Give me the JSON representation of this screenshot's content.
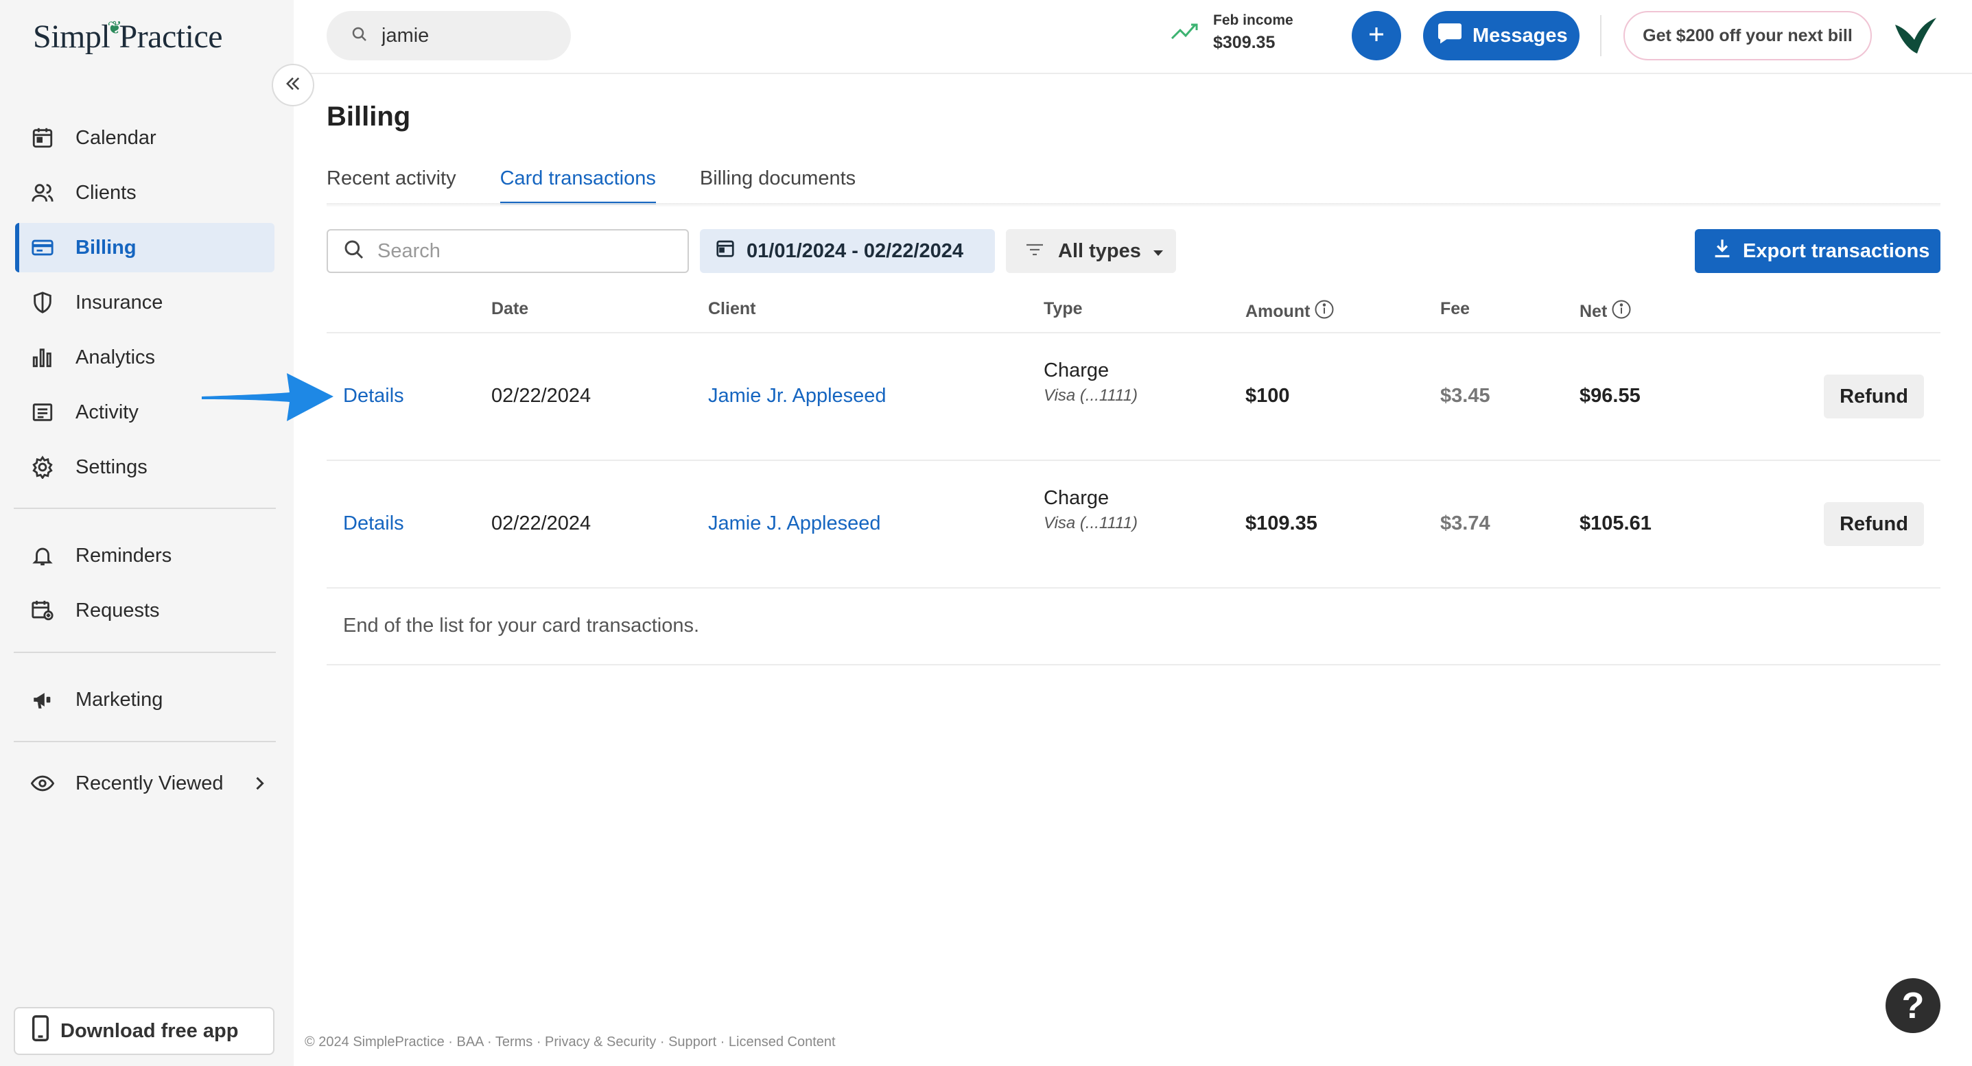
{
  "sidebar": {
    "logo_left": "Simpl",
    "logo_leaf": "❦",
    "logo_right": "Practice",
    "items": [
      {
        "label": "Calendar",
        "icon": "calendar-icon"
      },
      {
        "label": "Clients",
        "icon": "clients-icon"
      },
      {
        "label": "Billing",
        "icon": "billing-icon",
        "active": true
      },
      {
        "label": "Insurance",
        "icon": "shield-icon"
      },
      {
        "label": "Analytics",
        "icon": "analytics-icon"
      },
      {
        "label": "Activity",
        "icon": "activity-icon"
      },
      {
        "label": "Settings",
        "icon": "gear-icon"
      },
      {
        "label": "Reminders",
        "icon": "bell-icon"
      },
      {
        "label": "Requests",
        "icon": "requests-icon"
      },
      {
        "label": "Marketing",
        "icon": "megaphone-icon"
      },
      {
        "label": "Recently Viewed",
        "icon": "eye-icon"
      }
    ],
    "download_label": "Download free app"
  },
  "topbar": {
    "search_value": "jamie",
    "income_label": "Feb income",
    "income_value": "$309.35",
    "messages_label": "Messages",
    "promo_label": "Get $200 off your next bill"
  },
  "main": {
    "title": "Billing",
    "tabs": [
      {
        "label": "Recent activity",
        "active": false
      },
      {
        "label": "Card transactions",
        "active": true
      },
      {
        "label": "Billing documents",
        "active": false
      }
    ],
    "search_placeholder": "Search",
    "date_range": "01/01/2024 - 02/22/2024",
    "type_filter": "All types",
    "export_label": "Export transactions",
    "columns": {
      "date": "Date",
      "client": "Client",
      "type": "Type",
      "amount": "Amount",
      "fee": "Fee",
      "net": "Net"
    },
    "rows": [
      {
        "details": "Details",
        "date": "02/22/2024",
        "client": "Jamie Jr. Appleseed",
        "type": "Charge",
        "card": "Visa (...1111)",
        "amount": "$100",
        "fee": "$3.45",
        "net": "$96.55",
        "action": "Refund"
      },
      {
        "details": "Details",
        "date": "02/22/2024",
        "client": "Jamie J. Appleseed",
        "type": "Charge",
        "card": "Visa (...1111)",
        "amount": "$109.35",
        "fee": "$3.74",
        "net": "$105.61",
        "action": "Refund"
      }
    ],
    "end_text": "End of the list for your card transactions."
  },
  "footer": "© 2024 SimplePractice · BAA · Terms · Privacy & Security · Support · Licensed Content",
  "help_label": "?",
  "colors": {
    "accent": "#1565c0",
    "arrow": "#1e88e5",
    "sidebar_bg": "#f5f5f5"
  }
}
